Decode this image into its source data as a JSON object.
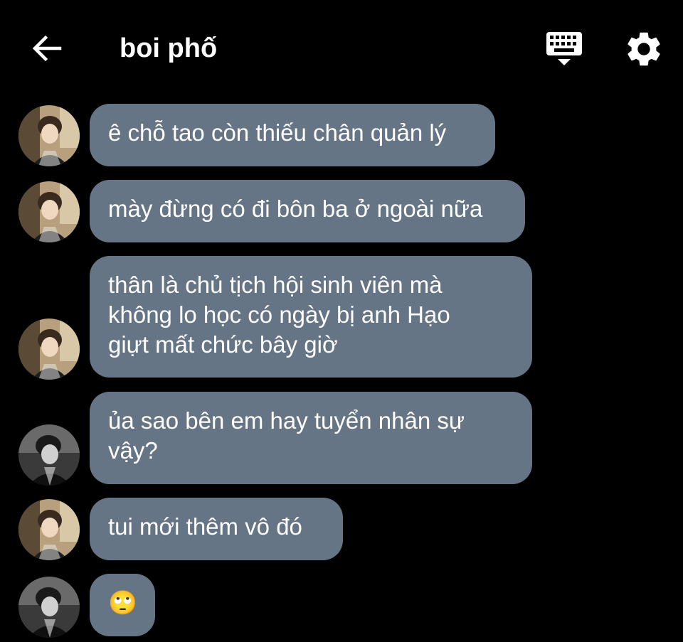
{
  "header": {
    "title": "boi phố",
    "back_icon": "arrow-left-icon",
    "keyboard_icon": "keyboard-icon",
    "settings_icon": "gear-icon"
  },
  "messages": [
    {
      "sender": "contact-a",
      "lines": [
        "ê chỗ tao còn thiếu chân quản lý"
      ]
    },
    {
      "sender": "contact-a",
      "lines": [
        "mày đừng có đi bôn ba ở ngoài nữa"
      ]
    },
    {
      "sender": "contact-a",
      "lines": [
        "thân là chủ tịch hội sinh viên mà",
        "không lo học có ngày bị anh Hạo",
        "giựt mất chức bây giờ"
      ]
    },
    {
      "sender": "contact-b",
      "lines": [
        "ủa sao bên em hay tuyển nhân sự",
        "vậy?"
      ]
    },
    {
      "sender": "contact-a",
      "lines": [
        "tui mới thêm vô đó"
      ]
    },
    {
      "sender": "contact-b",
      "lines": [
        "🙄"
      ]
    }
  ],
  "colors": {
    "background": "#000000",
    "bubble": "#657586",
    "text": "#ffffff"
  }
}
